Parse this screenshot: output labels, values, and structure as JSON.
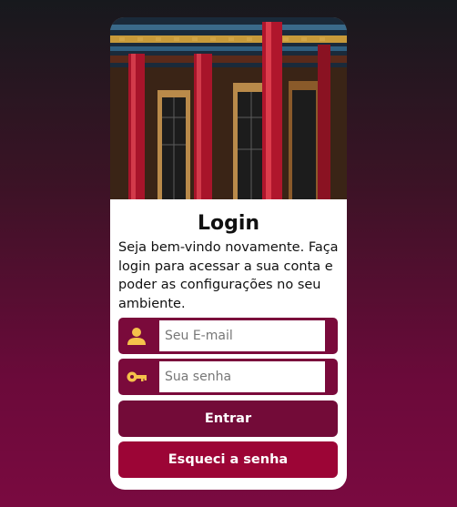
{
  "login": {
    "title": "Login",
    "description": "Seja bem-vindo novamente. Faça login para acessar a sua conta e poder as configurações no seu ambiente.",
    "email_placeholder": "Seu E-mail",
    "password_placeholder": "Sua senha",
    "submit_label": "Entrar",
    "forgot_label": "Esqueci a senha"
  },
  "icons": {
    "email": "user-icon",
    "password": "key-icon"
  },
  "colors": {
    "field_bg": "#7a0a3b",
    "icon": "#f5c24b",
    "primary_button": "#730b38",
    "secondary_button": "#9c0536"
  }
}
